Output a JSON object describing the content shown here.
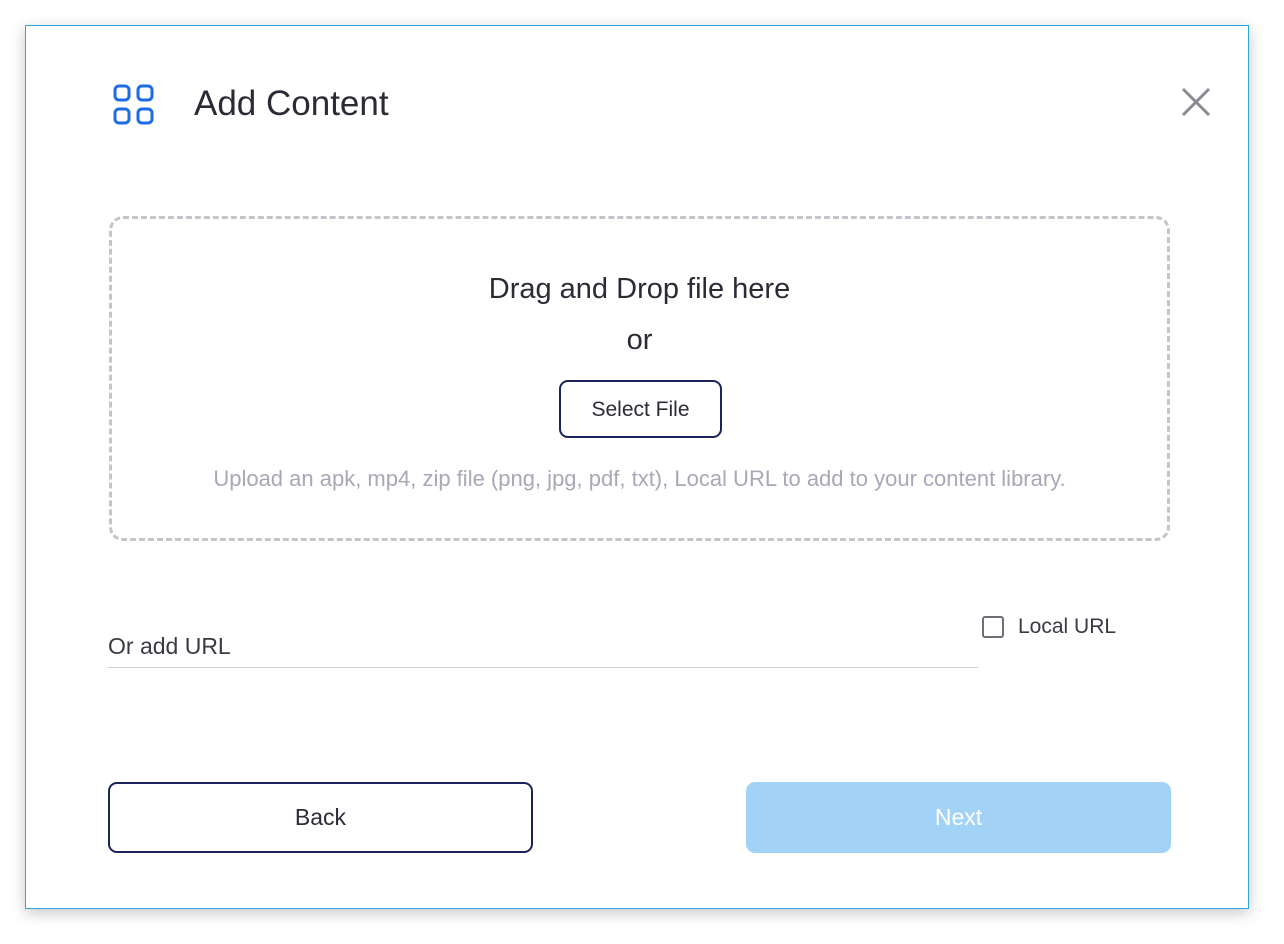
{
  "dialog": {
    "title": "Add Content",
    "header_icon": "grid-icon",
    "close_icon": "close-icon"
  },
  "dropzone": {
    "headline": "Drag and Drop file here",
    "separator": "or",
    "select_file_label": "Select File",
    "hint": "Upload an apk, mp4, zip file (png, jpg, pdf, txt), Local URL to add to your content library."
  },
  "url_input": {
    "placeholder": "Or add URL",
    "value": ""
  },
  "local_url_checkbox": {
    "label": "Local URL",
    "checked": false
  },
  "footer": {
    "back_label": "Back",
    "next_label": "Next",
    "next_disabled": true
  },
  "colors": {
    "accent": "#1e6be6",
    "modal_border": "#29a8e0",
    "button_border": "#1c2358",
    "next_disabled_bg": "#a2d3f7",
    "hint_text": "#a8a8b6"
  }
}
